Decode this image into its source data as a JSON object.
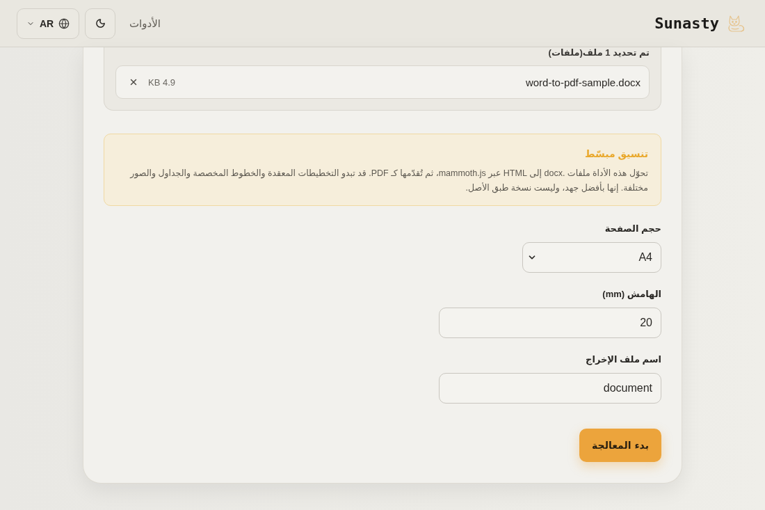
{
  "header": {
    "brand": "Sunasty",
    "nav_link": "الأدوات",
    "language": "AR"
  },
  "upload": {
    "summary": "تم تحديد 1 ملف(ملفات)",
    "files": [
      {
        "name": "word-to-pdf-sample.docx",
        "size": "KB 4.9"
      }
    ]
  },
  "notice": {
    "title": "تنسيق مبسّط",
    "text": "تحوّل هذه الأداة ملفات .docx إلى HTML عبر mammoth.js، ثم تُقدّمها كـ PDF. قد تبدو التخطيطات المعقدة والخطوط المخصصة والجداول والصور مختلفة. إنها بأفضل جهد، وليست نسخة طبق الأصل."
  },
  "form": {
    "fields": [
      {
        "kind": "select",
        "label": "حجم الصفحة",
        "value": "A4"
      },
      {
        "kind": "input",
        "label": "الهامش (mm)",
        "value": "20"
      },
      {
        "kind": "input",
        "label": "اسم ملف الإخراج",
        "value": "document"
      }
    ]
  },
  "submit_button": "بدء المعالجة"
}
